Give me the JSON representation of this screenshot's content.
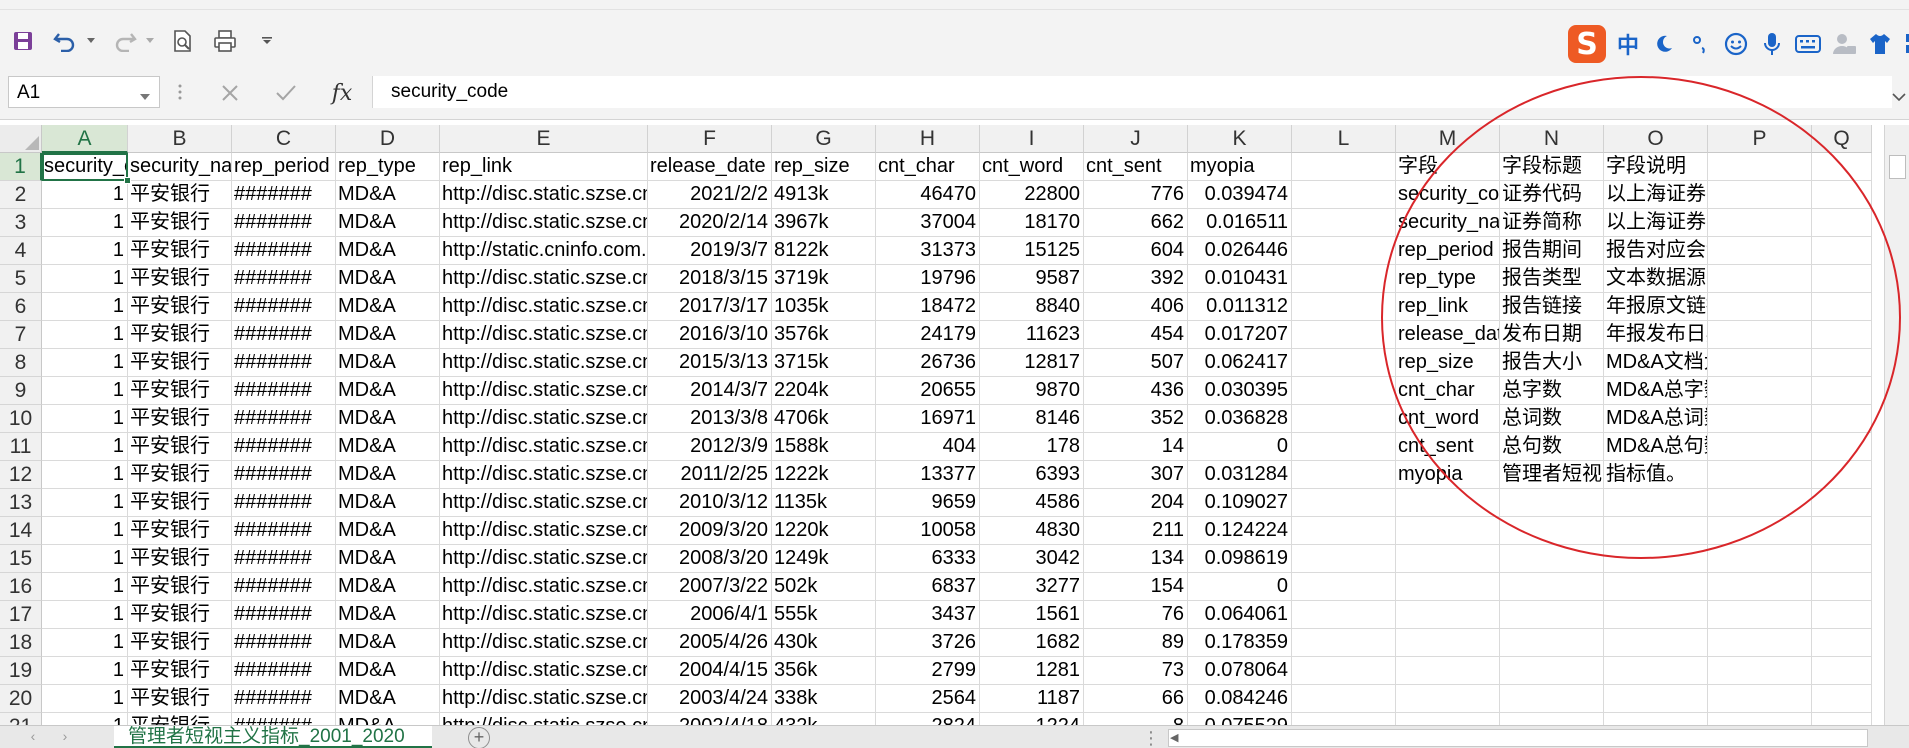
{
  "name_box": {
    "value": "A1"
  },
  "formula_bar": {
    "fx_label": "fx",
    "value": "security_code"
  },
  "ime": {
    "logo": "S",
    "mode_label": "中"
  },
  "sheet": {
    "tab_name": "管理者短视主义指标_2001_2020"
  },
  "columns": [
    "A",
    "B",
    "C",
    "D",
    "E",
    "F",
    "G",
    "H",
    "I",
    "J",
    "K",
    "L",
    "M",
    "N",
    "O",
    "P",
    "Q"
  ],
  "rows": [
    [
      "security_code",
      "security_name",
      "rep_period",
      "rep_type",
      "rep_link",
      "release_date",
      "rep_size",
      "cnt_char",
      "cnt_word",
      "cnt_sent",
      "myopia",
      "",
      "字段",
      "字段标题",
      "字段说明",
      "",
      ""
    ],
    [
      "1",
      "平安银行",
      "#######",
      "MD&A",
      "http://disc.static.szse.cn",
      "2021/2/2",
      "4913k",
      "46470",
      "22800",
      "776",
      "0.039474",
      "",
      "security_code",
      "证券代码",
      "以上海证券交易所和深圳证券",
      "",
      ""
    ],
    [
      "1",
      "平安银行",
      "#######",
      "MD&A",
      "http://disc.static.szse.cn",
      "2020/2/14",
      "3967k",
      "37004",
      "18170",
      "662",
      "0.016511",
      "",
      "security_name",
      "证券简称",
      "以上海证券交易所和深圳证券",
      "",
      ""
    ],
    [
      "1",
      "平安银行",
      "#######",
      "MD&A",
      "http://static.cninfo.com.cn",
      "2019/3/7",
      "8122k",
      "31373",
      "15125",
      "604",
      "0.026446",
      "",
      "rep_period",
      "报告期间",
      "报告对应会计期间截止日期",
      "",
      ""
    ],
    [
      "1",
      "平安银行",
      "#######",
      "MD&A",
      "http://disc.static.szse.cn",
      "2018/3/15",
      "3719k",
      "19796",
      "9587",
      "392",
      "0.010431",
      "",
      "rep_type",
      "报告类型",
      "文本数据源类型。",
      "",
      ""
    ],
    [
      "1",
      "平安银行",
      "#######",
      "MD&A",
      "http://disc.static.szse.cn",
      "2017/3/17",
      "1035k",
      "18472",
      "8840",
      "406",
      "0.011312",
      "",
      "rep_link",
      "报告链接",
      "年报原文链接。",
      "",
      ""
    ],
    [
      "1",
      "平安银行",
      "#######",
      "MD&A",
      "http://disc.static.szse.cn",
      "2016/3/10",
      "3576k",
      "24179",
      "11623",
      "454",
      "0.017207",
      "",
      "release_date",
      "发布日期",
      "年报发布日期。",
      "",
      ""
    ],
    [
      "1",
      "平安银行",
      "#######",
      "MD&A",
      "http://disc.static.szse.cn",
      "2015/3/13",
      "3715k",
      "26736",
      "12817",
      "507",
      "0.062417",
      "",
      "rep_size",
      "报告大小",
      "MD&A文档大小，单位：KB",
      "",
      ""
    ],
    [
      "1",
      "平安银行",
      "#######",
      "MD&A",
      "http://disc.static.szse.cn",
      "2014/3/7",
      "2204k",
      "20655",
      "9870",
      "436",
      "0.030395",
      "",
      "cnt_char",
      "总字数",
      "MD&A总字数。",
      "",
      ""
    ],
    [
      "1",
      "平安银行",
      "#######",
      "MD&A",
      "http://disc.static.szse.cn",
      "2013/3/8",
      "4706k",
      "16971",
      "8146",
      "352",
      "0.036828",
      "",
      "cnt_word",
      "总词数",
      "MD&A总词数。",
      "",
      ""
    ],
    [
      "1",
      "平安银行",
      "#######",
      "MD&A",
      "http://disc.static.szse.cn",
      "2012/3/9",
      "1588k",
      "404",
      "178",
      "14",
      "0",
      "",
      "cnt_sent",
      "总句数",
      "MD&A总句数。",
      "",
      ""
    ],
    [
      "1",
      "平安银行",
      "#######",
      "MD&A",
      "http://disc.static.szse.cn",
      "2011/2/25",
      "1222k",
      "13377",
      "6393",
      "307",
      "0.031284",
      "",
      "myopia",
      "管理者短视主义",
      "指标值。",
      "",
      ""
    ],
    [
      "1",
      "平安银行",
      "#######",
      "MD&A",
      "http://disc.static.szse.cn",
      "2010/3/12",
      "1135k",
      "9659",
      "4586",
      "204",
      "0.109027",
      "",
      "",
      "",
      "",
      "",
      ""
    ],
    [
      "1",
      "平安银行",
      "#######",
      "MD&A",
      "http://disc.static.szse.cn",
      "2009/3/20",
      "1220k",
      "10058",
      "4830",
      "211",
      "0.124224",
      "",
      "",
      "",
      "",
      "",
      ""
    ],
    [
      "1",
      "平安银行",
      "#######",
      "MD&A",
      "http://disc.static.szse.cn",
      "2008/3/20",
      "1249k",
      "6333",
      "3042",
      "134",
      "0.098619",
      "",
      "",
      "",
      "",
      "",
      ""
    ],
    [
      "1",
      "平安银行",
      "#######",
      "MD&A",
      "http://disc.static.szse.cn",
      "2007/3/22",
      "502k",
      "6837",
      "3277",
      "154",
      "0",
      "",
      "",
      "",
      "",
      "",
      ""
    ],
    [
      "1",
      "平安银行",
      "#######",
      "MD&A",
      "http://disc.static.szse.cn",
      "2006/4/1",
      "555k",
      "3437",
      "1561",
      "76",
      "0.064061",
      "",
      "",
      "",
      "",
      "",
      ""
    ],
    [
      "1",
      "平安银行",
      "#######",
      "MD&A",
      "http://disc.static.szse.cn",
      "2005/4/26",
      "430k",
      "3726",
      "1682",
      "89",
      "0.178359",
      "",
      "",
      "",
      "",
      "",
      ""
    ],
    [
      "1",
      "平安银行",
      "#######",
      "MD&A",
      "http://disc.static.szse.cn",
      "2004/4/15",
      "356k",
      "2799",
      "1281",
      "73",
      "0.078064",
      "",
      "",
      "",
      "",
      "",
      ""
    ],
    [
      "1",
      "平安银行",
      "#######",
      "MD&A",
      "http://disc.static.szse.cn",
      "2003/4/24",
      "338k",
      "2564",
      "1187",
      "66",
      "0.084246",
      "",
      "",
      "",
      "",
      "",
      ""
    ],
    [
      "1",
      "平安银行",
      "#######",
      "MD&A",
      "http://disc.static.szse.cn",
      "2002/4/18",
      "432k",
      "2824",
      "1224",
      "8",
      "0.075529",
      "",
      "",
      "",
      "",
      "",
      ""
    ]
  ],
  "numeric_columns": [
    0,
    5,
    7,
    8,
    9,
    10
  ],
  "row_numbers": [
    "1",
    "2",
    "3",
    "4",
    "5",
    "6",
    "7",
    "8",
    "9",
    "10",
    "11",
    "12",
    "13",
    "14",
    "15",
    "16",
    "17",
    "18",
    "19",
    "20",
    "21"
  ],
  "colors": {
    "accent": "#217346",
    "annotation": "#d9262a",
    "ime_brand": "#ee5a24",
    "ime_icons": "#1a64c8"
  }
}
